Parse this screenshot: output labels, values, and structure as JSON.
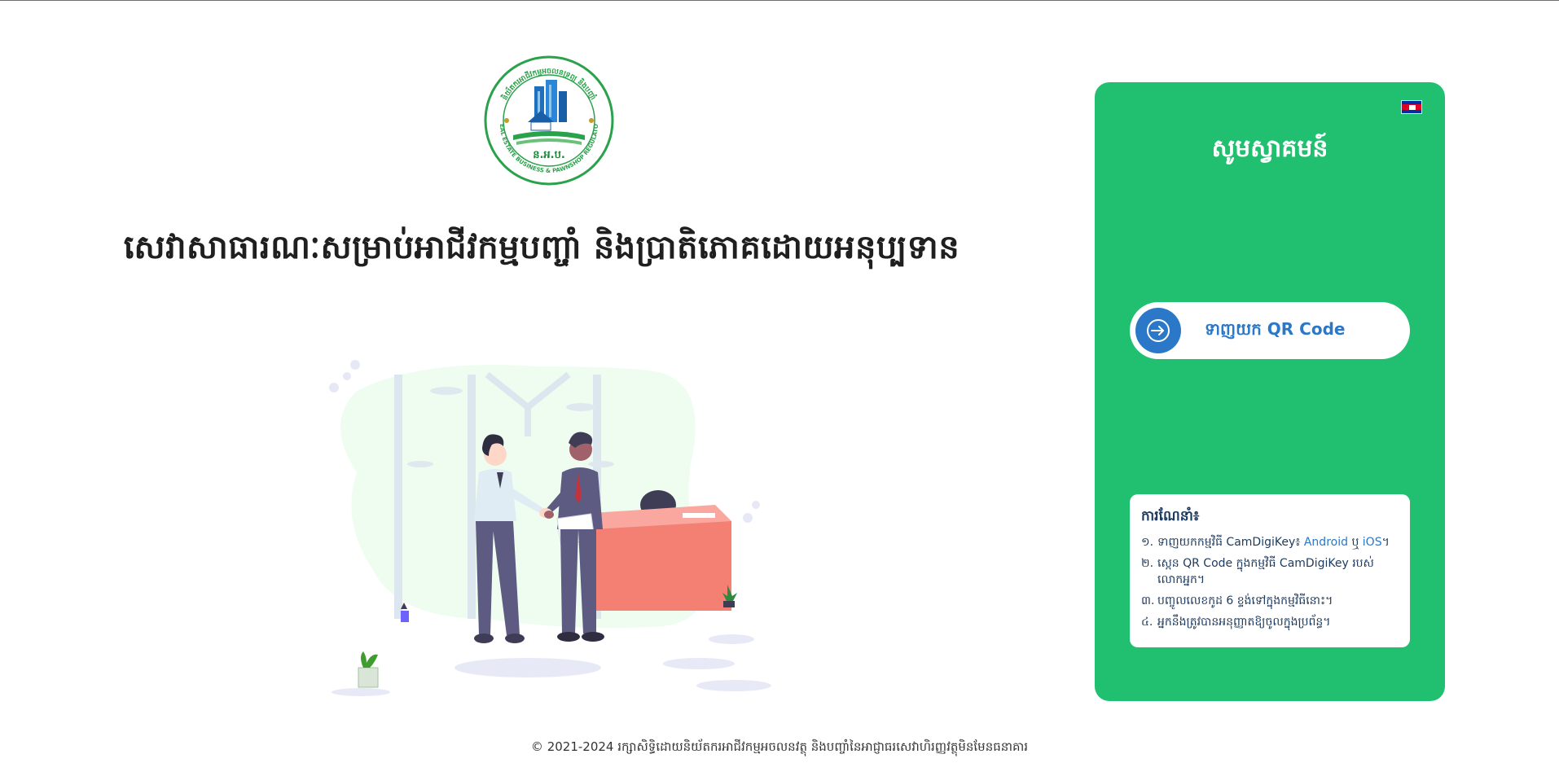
{
  "logo": {
    "ring_top_text": "និយ័តករអាជីវកម្មអចលនទ្រព្យ និងបញ្ចាំ",
    "ring_bottom_text": "REAL ESTATE BUSINESS & PAWNSHOP REGULATOR",
    "abbr": "ន.អ.ប."
  },
  "main_title": "សេវាសាធារណៈសម្រាប់អាជីវកម្មបញ្ចាំ និងប្រាតិភោគដោយអនុប្បទាន",
  "panel": {
    "welcome": "សូមស្វាគមន៍",
    "language_flag": "cambodia-flag",
    "qr_button_label": "ទាញយក QR Code",
    "instructions": {
      "heading": "ការណែនាំ៖",
      "items": [
        {
          "num": "១.",
          "text": "ទាញយកកម្មវិធី CamDigiKey៖ ",
          "link1": "Android",
          "sep": " ឬ ",
          "link2": "iOS",
          "end": "។"
        },
        {
          "num": "២.",
          "text": "ស្កេន QR Code ក្នុងកម្មវិធី CamDigiKey របស់លោកអ្នក។"
        },
        {
          "num": "៣.",
          "text": "បញ្ចូលលេខកូដ 6 ខ្ទង់ទៅក្នុងកម្មវិធីនោះ។"
        },
        {
          "num": "៤.",
          "text": "អ្នកនឹងត្រូវបានអនុញ្ញាតឱ្យចូលក្នុងប្រព័ន្ធ។"
        }
      ]
    }
  },
  "footer": "© 2021-2024 រក្សាសិទ្ធិដោយនិយ័តករអាជីវកម្មអចលនវត្ថុ និងបញ្ចាំនៃអាជ្ញាធរសេវាហិរញ្ញវត្ថុមិនមែនធនាគារ",
  "colors": {
    "panel_green": "#21c070",
    "accent_blue": "#2a78c7"
  }
}
